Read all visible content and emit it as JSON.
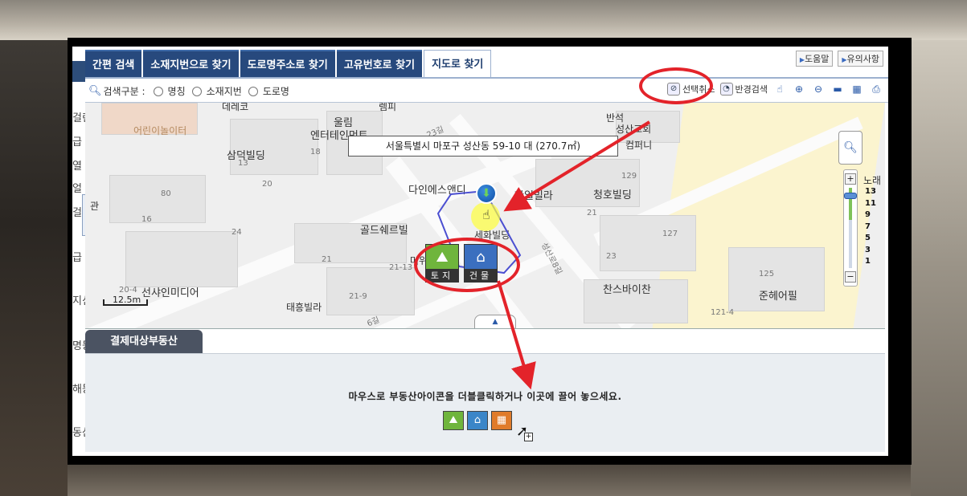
{
  "tabs": [
    {
      "label": "간편 검색"
    },
    {
      "label": "소재지번으로 찾기"
    },
    {
      "label": "도로명주소로 찾기"
    },
    {
      "label": "고유번호로 찾기"
    },
    {
      "label": "지도로 찾기",
      "active": true
    }
  ],
  "toplinks": {
    "help": "도움말",
    "notice": "유의사항"
  },
  "search": {
    "label": "검색구분 :",
    "options": [
      "명칭",
      "소재지번",
      "도로명"
    ]
  },
  "tools": {
    "cancel_select": "선택취소",
    "radius_search": "반경검색"
  },
  "left_fragments": [
    "걸린",
    "급",
    "열",
    "얼",
    "걸린",
    "급",
    "지신",
    "명등",
    "해등",
    "동산"
  ],
  "map": {
    "address_tooltip": "서울특별시 마포구 성산동 59-10 대 (270.7㎡)",
    "labels": [
      "어린이놀이터",
      "울림",
      "엔터테인먼트",
      "삼덕빌딩",
      "다인에스앤디",
      "한일빌라",
      "반석",
      "성산교회",
      "청호빌딩",
      "골드쉐르빌",
      "세화빌딩",
      "선샤인미디어",
      "태흥빌라",
      "찬스바이찬",
      "준헤어필",
      "데레코",
      "렘피",
      "노래",
      "관",
      "머위",
      "컴퍼니"
    ],
    "numbers": [
      "13",
      "18",
      "20",
      "80",
      "16",
      "24",
      "21",
      "21-13",
      "21-9",
      "20-4",
      "129",
      "21",
      "127",
      "23",
      "125",
      "121-4"
    ],
    "roads": [
      "23길",
      "성산로8길",
      "6길"
    ],
    "scale_label": "12.5m",
    "zoom_levels": [
      "13",
      "11",
      "9",
      "7",
      "5",
      "3",
      "1"
    ],
    "type_buttons": [
      {
        "label": "토지",
        "icon": "land-icon"
      },
      {
        "label": "건물",
        "icon": "building-icon"
      }
    ]
  },
  "panel": {
    "tab_label": "결제대상부동산",
    "message": "마우스로 부동산아이콘을 더블클릭하거나 이곳에 끌어 놓으세요."
  },
  "annotation_color": "#e3232a"
}
